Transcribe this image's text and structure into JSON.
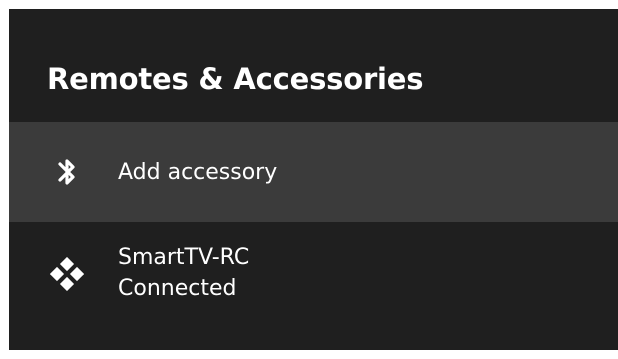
{
  "header": {
    "title": "Remotes & Accessories"
  },
  "menu": {
    "add_accessory": {
      "label": "Add accessory",
      "icon": "bluetooth-icon"
    },
    "paired_remote": {
      "name": "SmartTV-RC",
      "status": "Connected",
      "icon": "gamepad-icon"
    }
  },
  "colors": {
    "background": "#1f1f1f",
    "selected_row": "#3b3b3b",
    "text": "#ffffff"
  }
}
